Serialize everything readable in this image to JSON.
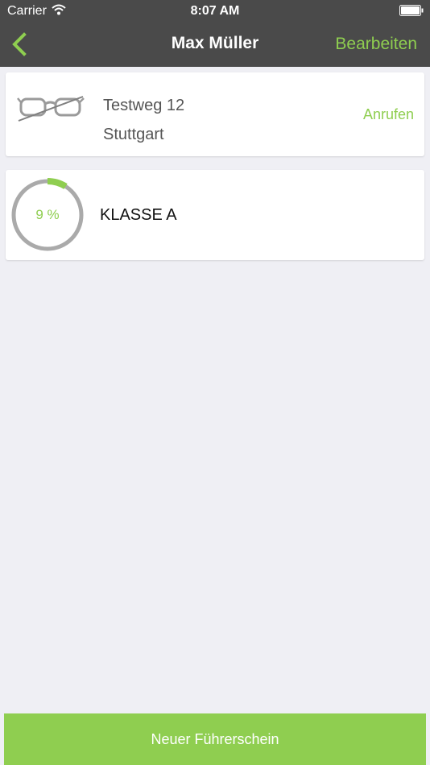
{
  "status_bar": {
    "carrier": "Carrier",
    "time": "8:07 AM"
  },
  "nav": {
    "title": "Max Müller",
    "edit_label": "Bearbeiten"
  },
  "address": {
    "street": "Testweg 12",
    "city": "Stuttgart",
    "call_label": "Anrufen",
    "icon": "glasses-icon"
  },
  "license": {
    "progress_text": "9 %",
    "progress_fraction": 0.09,
    "name": "KLASSE A"
  },
  "footer": {
    "button_label": "Neuer Führerschein"
  },
  "colors": {
    "accent": "#8fce50",
    "nav_background": "#4a4a4a",
    "page_background": "#efeff4",
    "ring_track": "#aaaaaa"
  }
}
